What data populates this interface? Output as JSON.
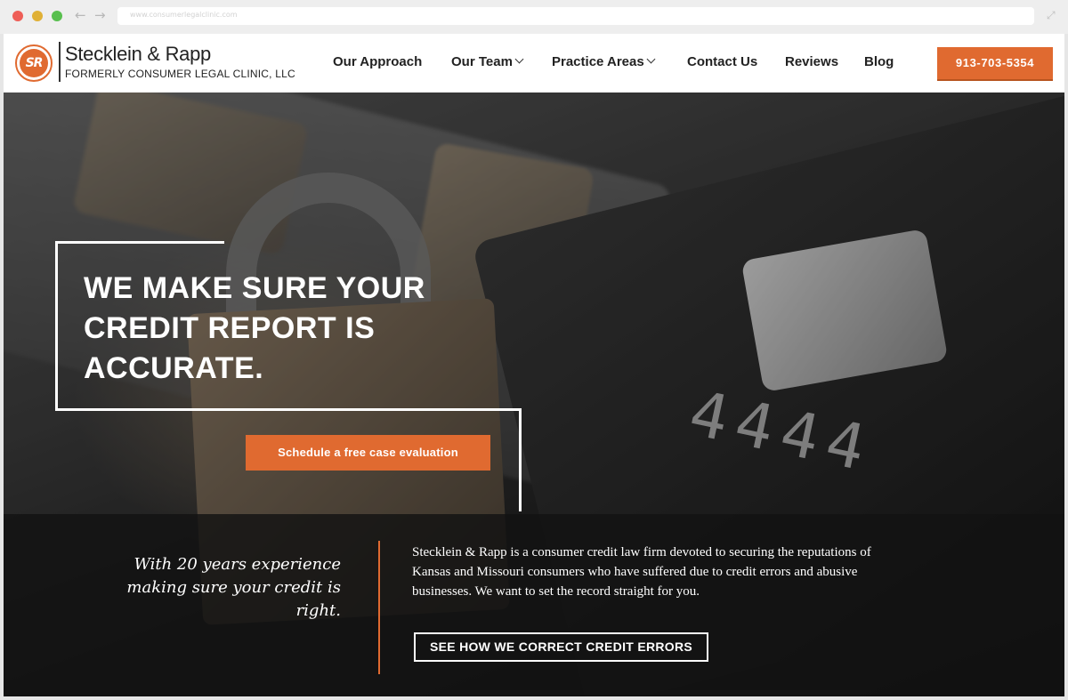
{
  "browser": {
    "url": "www.consumerlegalclinic.com"
  },
  "header": {
    "logo_mark": "SR",
    "logo_name": "Stecklein & Rapp",
    "logo_sub": "FORMERLY CONSUMER LEGAL CLINIC, LLC",
    "nav": [
      {
        "label": "Our Approach",
        "has_dropdown": false
      },
      {
        "label": "Our Team",
        "has_dropdown": true
      },
      {
        "label": "Practice Areas",
        "has_dropdown": true
      },
      {
        "label": "Contact Us",
        "has_dropdown": false
      },
      {
        "label": "Reviews",
        "has_dropdown": false
      },
      {
        "label": "Blog",
        "has_dropdown": false
      }
    ],
    "phone": "913-703-5354"
  },
  "hero": {
    "title_line1": "WE MAKE SURE YOUR",
    "title_line2": "CREDIT REPORT IS",
    "title_line3": "ACCURATE.",
    "cta_label": "Schedule a free case evaluation",
    "card_digits": "4444"
  },
  "band": {
    "quote": "With 20 years experience making sure your credit is right.",
    "description": "Stecklein & Rapp is a consumer credit law firm devoted to securing the reputations of Kansas and Missouri consumers who have suffered due to credit errors and abusive businesses. We want to set the record straight for you.",
    "button_label": "SEE HOW WE CORRECT CREDIT ERRORS"
  },
  "colors": {
    "accent": "#e06a30",
    "header_bg": "#ffffff",
    "band_bg": "#121212"
  }
}
